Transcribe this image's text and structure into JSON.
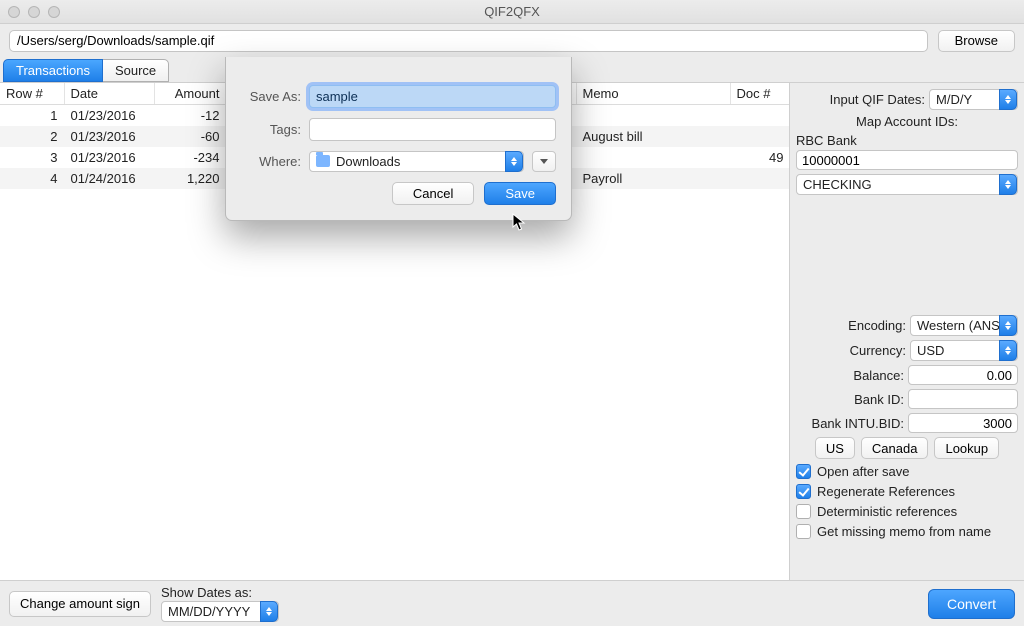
{
  "window": {
    "title": "QIF2QFX"
  },
  "path": {
    "value": "/Users/serg/Downloads/sample.qif",
    "browse": "Browse"
  },
  "tabs": [
    {
      "label": "Transactions",
      "active": true
    },
    {
      "label": "Source",
      "active": false
    }
  ],
  "table": {
    "cols": [
      "Row #",
      "Date",
      "Amount",
      "",
      "Memo",
      "Doc #"
    ],
    "rows": [
      {
        "n": "1",
        "date": "01/23/2016",
        "amount": "-12",
        "memo": "",
        "doc": ""
      },
      {
        "n": "2",
        "date": "01/23/2016",
        "amount": "-60",
        "memo": "August bill",
        "doc": ""
      },
      {
        "n": "3",
        "date": "01/23/2016",
        "amount": "-234",
        "memo": "",
        "doc": "49"
      },
      {
        "n": "4",
        "date": "01/24/2016",
        "amount": "1,220",
        "memo": "Payroll",
        "doc": ""
      }
    ]
  },
  "side": {
    "input_dates_label": "Input QIF Dates:",
    "input_dates_value": "M/D/Y",
    "map_label": "Map Account IDs:",
    "bank_name": "RBC Bank",
    "acct_id": "10000001",
    "acct_type": "CHECKING",
    "encoding_label": "Encoding:",
    "encoding_value": "Western (ANSI",
    "currency_label": "Currency:",
    "currency_value": "USD",
    "balance_label": "Balance:",
    "balance_value": "0.00",
    "bankid_label": "Bank ID:",
    "bankid_value": "",
    "intu_label": "Bank INTU.BID:",
    "intu_value": "3000",
    "btn_us": "US",
    "btn_canada": "Canada",
    "btn_lookup": "Lookup",
    "chk1": "Open after save",
    "chk2": "Regenerate References",
    "chk3": "Deterministic references",
    "chk4": "Get missing memo from name"
  },
  "footer": {
    "change_sign": "Change amount sign",
    "show_dates_label": "Show Dates as:",
    "show_dates_value": "MM/DD/YYYY",
    "convert": "Convert"
  },
  "sheet": {
    "save_as_label": "Save As:",
    "save_as_value": "sample",
    "tags_label": "Tags:",
    "tags_value": "",
    "where_label": "Where:",
    "where_value": "Downloads",
    "cancel": "Cancel",
    "save": "Save"
  }
}
